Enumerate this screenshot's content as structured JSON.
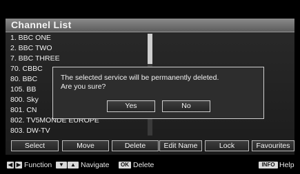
{
  "title": "Channel List",
  "channels": [
    "1. BBC ONE",
    "2. BBC TWO",
    "7. BBC THREE",
    "70. CBBC",
    "80. BBC",
    "105. BB",
    "800. Sky",
    "801. CN",
    "802. TV5MONDE EUROPE",
    "803. DW-TV"
  ],
  "function_buttons": [
    "Select",
    "Move",
    "Delete",
    "Edit Name",
    "Lock",
    "Favourites"
  ],
  "dialog": {
    "message_line1": "The selected service will be permanently deleted.",
    "message_line2": "Are you sure?",
    "yes_label": "Yes",
    "no_label": "No"
  },
  "help": {
    "function_label": "Function",
    "navigate_label": "Navigate",
    "ok_key": "OK",
    "delete_label": "Delete",
    "info_key": "INFO",
    "help_label": "Help"
  }
}
